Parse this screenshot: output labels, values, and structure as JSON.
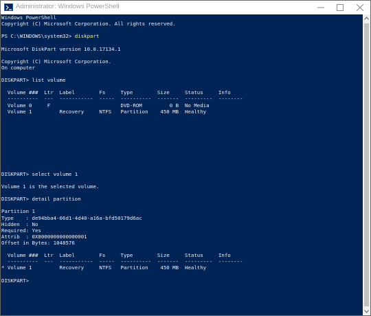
{
  "window": {
    "title": "Administrator: Windows PowerShell",
    "icon": "powershell-icon",
    "controls": [
      "minimize-icon",
      "maximize-icon",
      "close-icon"
    ]
  },
  "colors": {
    "console_background": "#012456",
    "console_text": "#eeedf0",
    "command_text": "#fdf26a",
    "titlebar_text": "#a0a0a0"
  },
  "console": {
    "lines": [
      {
        "text": "Windows PowerShell"
      },
      {
        "text": "Copyright (C) Microsoft Corporation. All rights reserved."
      },
      {
        "text": ""
      },
      {
        "text": "PS C:\\WINDOWS\\system32> ",
        "command": "diskpart"
      },
      {
        "text": ""
      },
      {
        "text": "Microsoft DiskPart version 10.0.17134.1"
      },
      {
        "text": ""
      },
      {
        "text": "Copyright (C) Microsoft Corporation."
      },
      {
        "text": "On computer"
      },
      {
        "text": ""
      },
      {
        "text": "DISKPART> list volume"
      },
      {
        "text": ""
      },
      {
        "text": "  Volume ###  Ltr  Label        Fs     Type        Size     Status     Info"
      },
      {
        "text": "  ----------  ---  -----------  -----  ----------  -------  ---------  --------"
      },
      {
        "text": "  Volume 0     F                       DVD-ROM         0 B  No Media"
      },
      {
        "text": "  Volume 1         Recovery     NTFS   Partition    450 MB  Healthy"
      },
      {
        "text": ""
      },
      {
        "text": ""
      },
      {
        "text": ""
      },
      {
        "text": ""
      },
      {
        "text": ""
      },
      {
        "text": ""
      },
      {
        "text": ""
      },
      {
        "text": ""
      },
      {
        "text": ""
      },
      {
        "text": "DISKPART> select volume 1"
      },
      {
        "text": ""
      },
      {
        "text": "Volume 1 is the selected volume."
      },
      {
        "text": ""
      },
      {
        "text": "DISKPART> detail partition"
      },
      {
        "text": ""
      },
      {
        "text": "Partition 1"
      },
      {
        "text": "Type    : de94bba4-06d1-4d40-a16a-bfd50179d6ac"
      },
      {
        "text": "Hidden  : No"
      },
      {
        "text": "Required: Yes"
      },
      {
        "text": "Attrib  : 0X8000000000000001"
      },
      {
        "text": "Offset in Bytes: 1048576"
      },
      {
        "text": ""
      },
      {
        "text": "  Volume ###  Ltr  Label        Fs     Type        Size     Status     Info"
      },
      {
        "text": "  ----------  ---  -----------  -----  ----------  -------  ---------  --------"
      },
      {
        "text": "* Volume 1         Recovery     NTFS   Partition    450 MB  Healthy"
      },
      {
        "text": ""
      },
      {
        "text": "DISKPART>"
      }
    ]
  }
}
